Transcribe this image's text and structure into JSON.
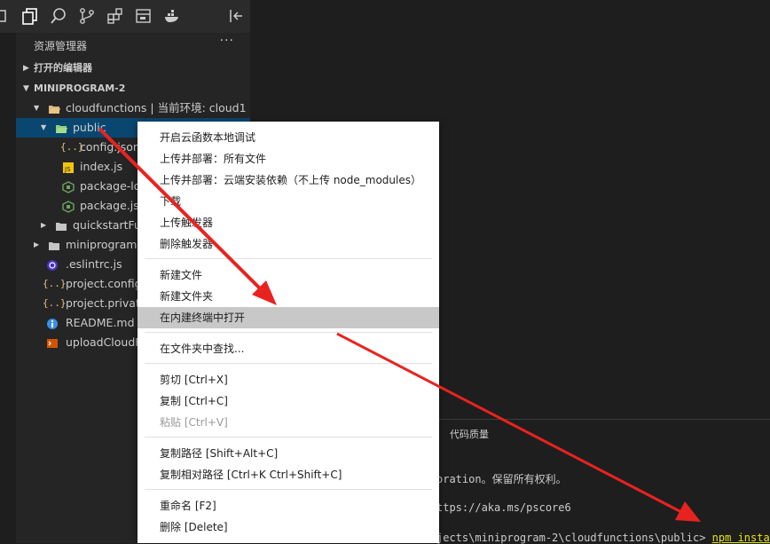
{
  "sidebar": {
    "title": "资源管理器",
    "more": "···",
    "open_editors": "打开的编辑器",
    "project": "MINIPROGRAM-2"
  },
  "tree": [
    {
      "label": "cloudfunctions | 当前环境: cloud1",
      "icon": "folder-open-icon"
    },
    {
      "label": "public",
      "icon": "folder-open-icon",
      "selected": true
    },
    {
      "label": "config.json",
      "icon": "json-icon"
    },
    {
      "label": "index.js",
      "icon": "js-icon"
    },
    {
      "label": "package-lo",
      "icon": "npm-icon"
    },
    {
      "label": "package.jso",
      "icon": "npm-icon"
    },
    {
      "label": "quickstartFun",
      "icon": "folder-icon"
    },
    {
      "label": "miniprogram",
      "icon": "folder-icon"
    },
    {
      "label": ".eslintrc.js",
      "icon": "eslint-icon"
    },
    {
      "label": "project.config.",
      "icon": "json-icon"
    },
    {
      "label": "project.private",
      "icon": "json-icon"
    },
    {
      "label": "README.md",
      "icon": "info-icon"
    },
    {
      "label": "uploadCloudF",
      "icon": "shell-icon"
    }
  ],
  "context_menu": [
    "开启云函数本地调试",
    "上传并部署：所有文件",
    "上传并部署：云端安装依赖（不上传 node_modules）",
    "下载",
    "上传触发器",
    "删除触发器",
    "新建文件",
    "新建文件夹",
    "在内建终端中打开",
    "在文件夹中查找...",
    "剪切  [Ctrl+X]",
    "复制  [Ctrl+C]",
    "粘贴  [Ctrl+V]",
    "复制路径  [Shift+Alt+C]",
    "复制相对路径  [Ctrl+K Ctrl+Shift+C]",
    "重命名  [F2]",
    "删除  [Delete]"
  ],
  "panel": {
    "tab": "代码质量",
    "line1": "oration。保留所有权利。",
    "line2": "ttps://aka.ms/pscore6",
    "line3_prefix": "jects\\miniprogram-2\\cloudfunctions\\public> ",
    "line3_cmd": "npm install"
  },
  "colors": {
    "accent_arrow": "#e8231f",
    "selection": "#094771",
    "menu_highlight": "#c8c8c8"
  }
}
